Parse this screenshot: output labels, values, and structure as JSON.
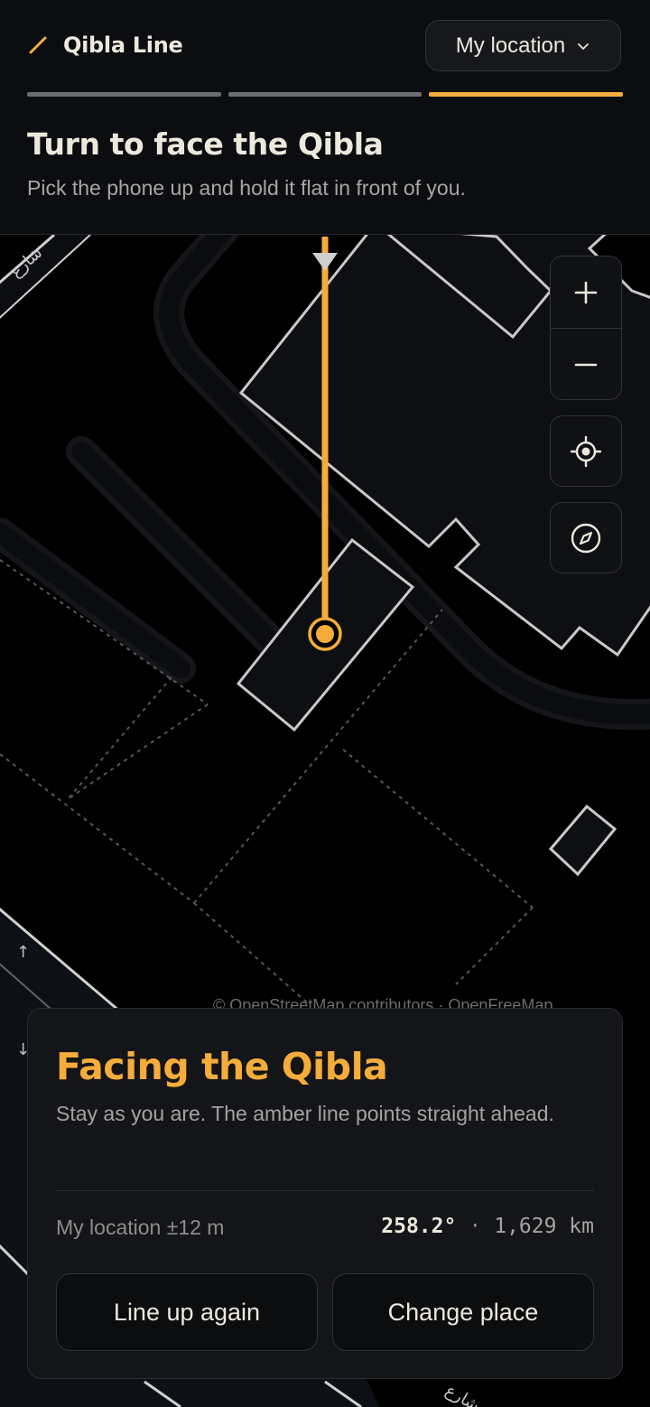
{
  "header": {
    "app_title": "Qibla Line",
    "brand_icon": "line-icon",
    "location_selector": {
      "label": "My location",
      "icon": "chevron-down-icon"
    },
    "steps": [
      {
        "state": "done"
      },
      {
        "state": "done"
      },
      {
        "state": "active"
      }
    ],
    "instruction": {
      "title": "Turn to face the Qibla",
      "subtitle": "Pick the phone up and hold it flat in front of you."
    }
  },
  "map": {
    "controls": {
      "zoom_in_icon": "plus-icon",
      "zoom_out_icon": "minus-icon",
      "recenter_icon": "crosshair-icon",
      "compass_icon": "compass-icon"
    },
    "attribution": "© OpenStreetMap contributors · OpenFreeMap"
  },
  "panel": {
    "title": "Facing the Qibla",
    "subtitle": "Stay as you are. The amber line points straight ahead.",
    "location_label": "My location ±12 m",
    "bearing": "258.2°",
    "separator": "·",
    "distance": "1,629 km",
    "buttons": {
      "line_up": "Line up again",
      "change_place": "Change place"
    }
  },
  "colors": {
    "accent": "#f5ac3b",
    "background": "#000000",
    "surface": "#141518",
    "header_bg": "#0c0d10"
  }
}
